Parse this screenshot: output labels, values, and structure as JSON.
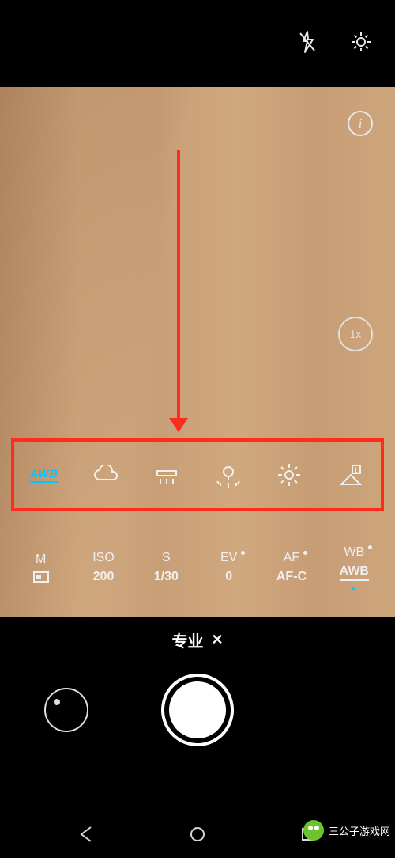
{
  "topbar": {
    "flash_icon": "flash-off",
    "settings_icon": "gear"
  },
  "viewfinder": {
    "info_label": "i",
    "zoom_label": "1x"
  },
  "wb_options": [
    {
      "name": "awb",
      "label": "AWB",
      "selected": true
    },
    {
      "name": "cloudy",
      "label": ""
    },
    {
      "name": "fluorescent",
      "label": ""
    },
    {
      "name": "incandescent",
      "label": ""
    },
    {
      "name": "daylight",
      "label": ""
    },
    {
      "name": "manual",
      "label": ""
    }
  ],
  "params": {
    "metering": {
      "label": "M",
      "value": ""
    },
    "iso": {
      "label": "ISO",
      "value": "200"
    },
    "shutter": {
      "label": "S",
      "value": "1/30"
    },
    "ev": {
      "label": "EV",
      "value": "0"
    },
    "af": {
      "label": "AF",
      "value": "AF-C"
    },
    "wb": {
      "label": "WB",
      "value": "AWB"
    }
  },
  "mode": {
    "label": "专业",
    "close": "✕"
  },
  "watermark": {
    "text": "三公子游戏网"
  }
}
